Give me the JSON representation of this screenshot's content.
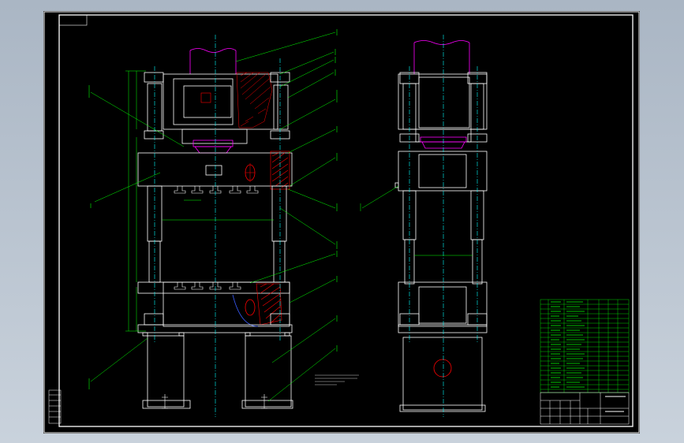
{
  "app": {
    "title": "",
    "background": "#000000",
    "frame_color": "#ffffff",
    "colors": {
      "outline": "#ffffff",
      "centerline": "#00ffff",
      "leader": "#00ff00",
      "bearing_plate": "#ff00ff",
      "section": "#ff0000",
      "parts_table": "#00ff00"
    }
  },
  "drawing": {
    "views": [
      "front-section-view",
      "side-view"
    ],
    "parts_list_rows": 18
  }
}
